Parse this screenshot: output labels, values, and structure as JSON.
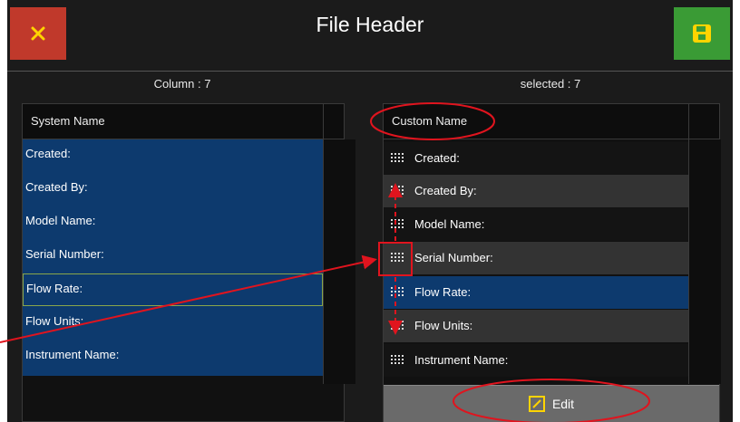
{
  "header": {
    "title": "File Header",
    "close_icon": "close-icon",
    "save_icon": "save-icon",
    "accent_close": "#c0392b",
    "accent_save": "#3a9b35"
  },
  "left": {
    "count_label": "Column : 7",
    "column_header": "System Name",
    "items": [
      "Created:",
      "Created By:",
      "Model Name:",
      "Serial Number:",
      "Flow Rate:",
      "Flow Units:",
      "Instrument Name:"
    ],
    "selected_index": 4
  },
  "right": {
    "count_label": "selected : 7",
    "column_header": "Custom Name",
    "items": [
      "Created:",
      "Created By:",
      "Model Name:",
      "Serial Number:",
      "Flow Rate:",
      "Flow Units:",
      "Instrument Name:"
    ],
    "selected_index": 4,
    "edit_label": "Edit"
  },
  "annotation_color": "#e0141e"
}
